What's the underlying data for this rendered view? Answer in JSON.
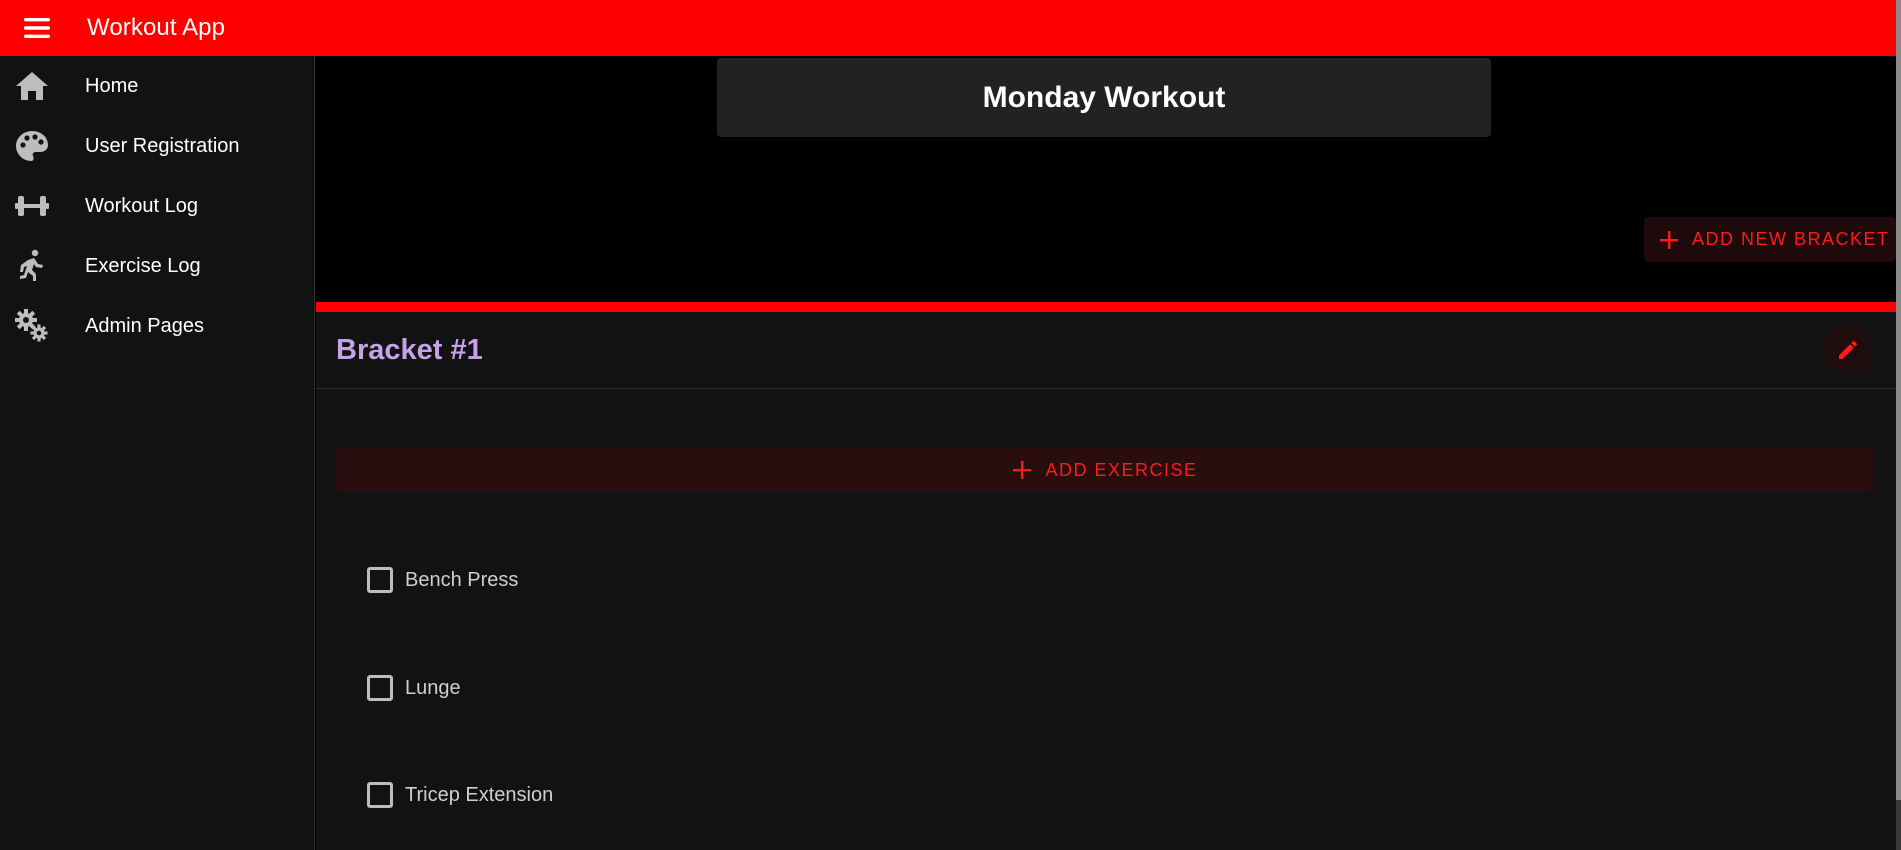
{
  "app": {
    "title": "Workout App",
    "colors": {
      "appbar": "#ff0000",
      "accent": "#ff1a1a",
      "bracket_title": "#c7a0ea"
    }
  },
  "sidebar": {
    "items": [
      {
        "label": "Home",
        "icon": "home-icon"
      },
      {
        "label": "User Registration",
        "icon": "palette-icon"
      },
      {
        "label": "Workout Log",
        "icon": "dumbbell-icon"
      },
      {
        "label": "Exercise Log",
        "icon": "running-person-icon"
      },
      {
        "label": "Admin Pages",
        "icon": "gears-icon"
      }
    ]
  },
  "workout": {
    "title": "Monday Workout"
  },
  "actions": {
    "add_bracket_label": "ADD NEW BRACKET",
    "add_exercise_label": "ADD EXERCISE"
  },
  "bracket": {
    "title": "Bracket #1",
    "exercises": [
      {
        "name": "Bench Press",
        "checked": false
      },
      {
        "name": "Lunge",
        "checked": false
      },
      {
        "name": "Tricep Extension",
        "checked": false
      }
    ]
  }
}
